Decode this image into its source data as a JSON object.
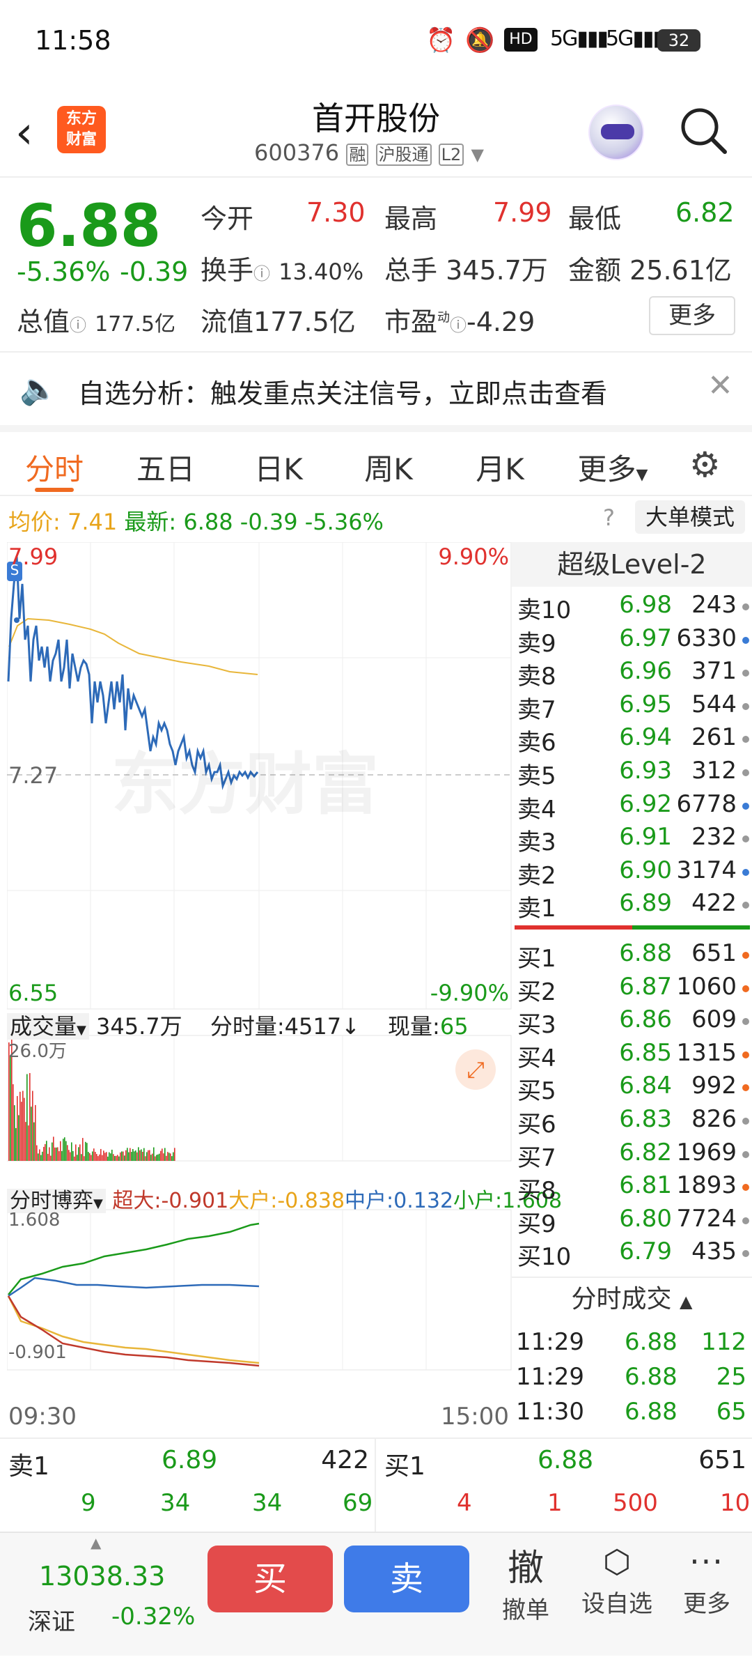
{
  "status": {
    "time": "11:58",
    "battery": "32"
  },
  "header": {
    "logo_line1": "东方",
    "logo_line2": "财富",
    "title": "首开股份",
    "code": "600376",
    "tag_rong": "融",
    "tag_hgt": "沪股通",
    "tag_l2": "L2"
  },
  "quote": {
    "price": "6.88",
    "pct": "-5.36%",
    "chg": "-0.39",
    "open_label": "今开",
    "open": "7.30",
    "high_label": "最高",
    "high": "7.99",
    "low_label": "最低",
    "low": "6.82",
    "turnover_label": "换手",
    "turnover": "13.40%",
    "volume_label": "总手",
    "volume": "345.7万",
    "amount_label": "金额",
    "amount": "25.61亿",
    "mktcap_label": "总值",
    "mktcap": "177.5亿",
    "float_label": "流值",
    "float": "177.5亿",
    "pe_label": "市盈",
    "pe_sup": "动",
    "pe": "-4.29",
    "more_button": "更多"
  },
  "notice": {
    "text": "自选分析：触发重点关注信号，立即点击查看"
  },
  "tabs": [
    "分时",
    "五日",
    "日K",
    "周K",
    "月K",
    "更多"
  ],
  "avg": {
    "avg_label": "均价:",
    "avg": "7.41",
    "latest_label": "最新:",
    "latest": "6.88",
    "chg": "-0.39",
    "pct": "-5.36%",
    "big_mode": "大单模式"
  },
  "chart": {
    "price_high": "7.99",
    "pct_high": "9.90%",
    "price_mid": "7.27",
    "price_low": "6.55",
    "pct_low": "-9.90%",
    "watermark": "东方财富",
    "vol_label": "成交量",
    "vol_total": "345.7万",
    "vol_fen_label": "分时量:",
    "vol_fen": "4517",
    "vol_now_label": "现量:",
    "vol_now": "65",
    "vol_max": "26.0万",
    "game_label": "分时博弈",
    "super_label": "超大:",
    "super": "-0.901",
    "big_label": "大户:",
    "big": "-0.838",
    "mid_label": "中户:",
    "mid": "0.132",
    "small_label": "小户:",
    "small": "1.608",
    "game_max": "1.608",
    "game_min": "-0.901",
    "time_start": "09:30",
    "time_end": "15:00"
  },
  "level2": {
    "title": "超级Level-2",
    "asks": [
      {
        "label": "卖10",
        "price": "6.98",
        "vol": "243",
        "dot": "#999"
      },
      {
        "label": "卖9",
        "price": "6.97",
        "vol": "6330",
        "dot": "#3a7bd5"
      },
      {
        "label": "卖8",
        "price": "6.96",
        "vol": "371",
        "dot": "#999"
      },
      {
        "label": "卖7",
        "price": "6.95",
        "vol": "544",
        "dot": "#999"
      },
      {
        "label": "卖6",
        "price": "6.94",
        "vol": "261",
        "dot": "#999"
      },
      {
        "label": "卖5",
        "price": "6.93",
        "vol": "312",
        "dot": "#999"
      },
      {
        "label": "卖4",
        "price": "6.92",
        "vol": "6778",
        "dot": "#3a7bd5"
      },
      {
        "label": "卖3",
        "price": "6.91",
        "vol": "232",
        "dot": "#999"
      },
      {
        "label": "卖2",
        "price": "6.90",
        "vol": "3174",
        "dot": "#3a7bd5"
      },
      {
        "label": "卖1",
        "price": "6.89",
        "vol": "422",
        "dot": "#999"
      }
    ],
    "bids": [
      {
        "label": "买1",
        "price": "6.88",
        "vol": "651",
        "dot": "#f06a20"
      },
      {
        "label": "买2",
        "price": "6.87",
        "vol": "1060",
        "dot": "#f06a20"
      },
      {
        "label": "买3",
        "price": "6.86",
        "vol": "609",
        "dot": "#999"
      },
      {
        "label": "买4",
        "price": "6.85",
        "vol": "1315",
        "dot": "#f06a20"
      },
      {
        "label": "买5",
        "price": "6.84",
        "vol": "992",
        "dot": "#f06a20"
      },
      {
        "label": "买6",
        "price": "6.83",
        "vol": "826",
        "dot": "#999"
      },
      {
        "label": "买7",
        "price": "6.82",
        "vol": "1969",
        "dot": "#999"
      },
      {
        "label": "买8",
        "price": "6.81",
        "vol": "1893",
        "dot": "#f06a20"
      },
      {
        "label": "买9",
        "price": "6.80",
        "vol": "7724",
        "dot": "#999"
      },
      {
        "label": "买10",
        "price": "6.79",
        "vol": "435",
        "dot": "#999"
      }
    ],
    "trades_title": "分时成交",
    "trades": [
      {
        "time": "11:29",
        "price": "6.88",
        "vol": "112"
      },
      {
        "time": "11:29",
        "price": "6.88",
        "vol": "25"
      },
      {
        "time": "11:30",
        "price": "6.88",
        "vol": "65"
      }
    ]
  },
  "bottom_quote": {
    "ask_label": "卖1",
    "ask_price": "6.89",
    "ask_vol": "422",
    "ask_nums": [
      "9",
      "34",
      "34",
      "69"
    ],
    "bid_label": "买1",
    "bid_price": "6.88",
    "bid_vol": "651",
    "bid_nums": [
      "4",
      "1",
      "500",
      "10"
    ]
  },
  "nav": {
    "index_value": "13038.33",
    "index_name": "深证",
    "index_pct": "-0.32%",
    "buy": "买",
    "sell": "卖",
    "cancel_icon": "撤",
    "cancel": "撤单",
    "watch": "设自选",
    "more": "更多"
  }
}
